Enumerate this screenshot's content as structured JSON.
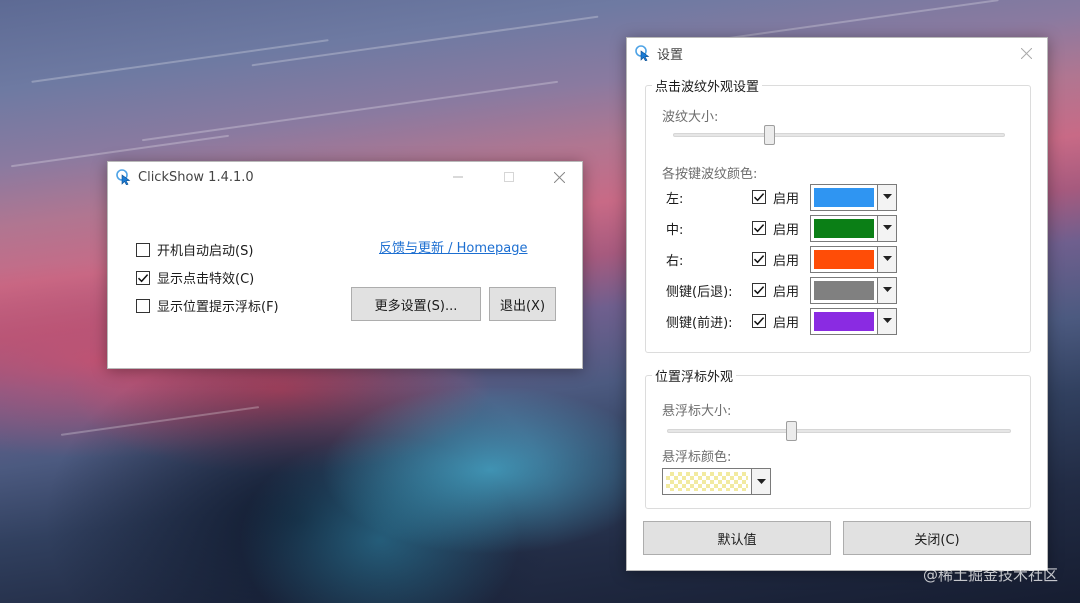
{
  "main_window": {
    "title": "ClickShow 1.4.1.0",
    "options": [
      {
        "label": "开机自动启动(S)",
        "checked": false
      },
      {
        "label": "显示点击特效(C)",
        "checked": true
      },
      {
        "label": "显示位置提示浮标(F)",
        "checked": false
      }
    ],
    "feedback_link": "反馈与更新 / Homepage",
    "more_settings_button": "更多设置(S)...",
    "exit_button": "退出(X)"
  },
  "settings_window": {
    "title": "设置",
    "ripple_group": {
      "title": "点击波纹外观设置",
      "size_label": "波纹大小:",
      "size_value_fraction": 0.29,
      "colors_label": "各按键波纹颜色:",
      "enable_label": "启用",
      "rows": [
        {
          "label": "左:",
          "enabled": true,
          "color": "#2f95f2"
        },
        {
          "label": "中:",
          "enabled": true,
          "color": "#0b7f16"
        },
        {
          "label": "右:",
          "enabled": true,
          "color": "#ff4d07"
        },
        {
          "label": "侧键(后退):",
          "enabled": true,
          "color": "#808080"
        },
        {
          "label": "侧键(前进):",
          "enabled": true,
          "color": "#8a2be2"
        }
      ]
    },
    "indicator_group": {
      "title": "位置浮标外观",
      "size_label": "悬浮标大小:",
      "size_value_fraction": 0.36,
      "color_label": "悬浮标颜色:",
      "color": "#f2eaa0"
    },
    "default_button": "默认值",
    "close_button": "关闭(C)"
  },
  "watermark": "@稀土掘金技术社区"
}
